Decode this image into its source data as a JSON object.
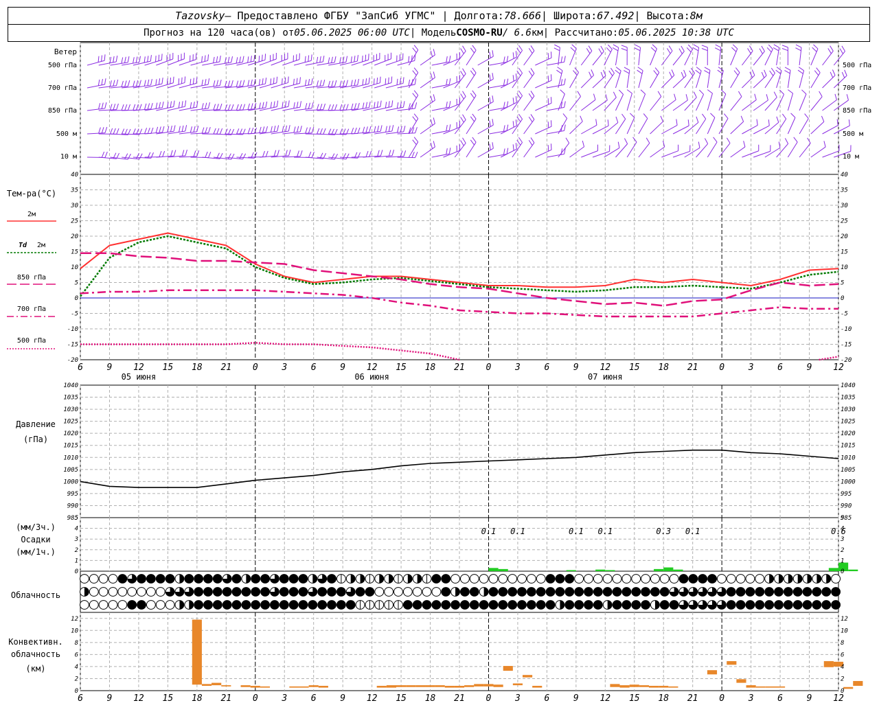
{
  "header": {
    "station": "Tazovsky",
    "provider": " – Предоставлено ФГБУ \"ЗапСиб УГМС\" | Долгота: ",
    "lon": "78.666",
    "lat_label": " | Широта: ",
    "lat": "67.492",
    "alt_label": " | Высота: ",
    "alt": "8м",
    "fc_prefix": "Прогноз на 120 часа(ов) от ",
    "fc_date": "05.06.2025 06:00 UTC",
    "model_label": "  | Модель ",
    "model": "COSMO-RU",
    "model_res": " / 6.6",
    "model_unit": "км",
    "calc_label": " | Рассчитано: ",
    "calc_date": "05.06.2025 10:38 UTC"
  },
  "colors": {
    "wind": "#8a2be2",
    "t2m": "#ff3030",
    "td2m": "#007a00",
    "t850": "#e0107a",
    "t700": "#e0107a",
    "t500": "#e0107a",
    "zero_line": "#1010c0",
    "pressure": "#000000",
    "precip": "#22cc22",
    "convective": "#e8872a"
  },
  "labels": {
    "wind_title": "Ветер",
    "wind_levels": [
      "500 гПа",
      "700 гПа",
      "850 гПа",
      "500 м",
      "10  м"
    ],
    "temp_title": "Тем-ра(°C)",
    "t2m": "2м",
    "td_a": "Td",
    "td_b": "2м",
    "t850": "850 гПа",
    "t700": "700 гПа",
    "t500": "500 гПа",
    "pressure_a": "Давление",
    "pressure_b": "(гПа)",
    "precip_a": "(мм/3ч.)",
    "precip_b": "Осадки",
    "precip_c": "(мм/1ч.)",
    "clouds": "Облачность",
    "conv_a": "Конвективн.",
    "conv_b": "облачность",
    "conv_c": "(км)"
  },
  "chart_data": [
    {
      "id": "wind",
      "type": "wind_barbs",
      "title": "Ветер",
      "levels": [
        "500 гПа",
        "700 гПа",
        "850 гПа",
        "500 м",
        "10  м"
      ]
    },
    {
      "id": "temperature",
      "type": "line",
      "ylabel": "Тем-ра(°C)",
      "ylim": [
        -20,
        40
      ],
      "yticks": [
        -20,
        -15,
        -10,
        -5,
        0,
        5,
        10,
        15,
        20,
        25,
        30,
        35,
        40
      ],
      "x_hours_from_start": [
        0,
        3,
        6,
        9,
        12,
        15,
        18,
        21,
        24,
        27,
        30,
        33,
        36,
        39,
        42,
        45,
        48,
        51,
        54,
        57,
        60,
        63,
        66,
        69,
        72,
        75,
        78
      ],
      "series": [
        {
          "name": "2м",
          "values": [
            9.5,
            17,
            19,
            21,
            19,
            17,
            11,
            7,
            5,
            6,
            7,
            7,
            6,
            5,
            4,
            4,
            3.5,
            3.5,
            4,
            6,
            5,
            6,
            5,
            4,
            6,
            9,
            9.5
          ]
        },
        {
          "name": "Td 2м",
          "values": [
            0.5,
            13,
            18,
            20,
            18,
            16,
            10,
            6.5,
            4.5,
            5,
            6,
            6.5,
            5.5,
            4.5,
            3.5,
            3,
            2.5,
            2,
            2.5,
            3.5,
            3.5,
            4,
            3.5,
            3,
            5,
            7.5,
            8.5
          ]
        },
        {
          "name": "850 гПа",
          "values": [
            14.5,
            14.5,
            13.5,
            13,
            12,
            12,
            11.5,
            11,
            9,
            8,
            7,
            6,
            4.5,
            3.5,
            3,
            1.5,
            0,
            -1,
            -2,
            -1.5,
            -2.5,
            -1,
            -0.5,
            2.5,
            5,
            4,
            4.5
          ]
        },
        {
          "name": "700 гПа",
          "values": [
            1.5,
            2,
            2,
            2.5,
            2.5,
            2.5,
            2.5,
            2,
            1.5,
            1,
            0,
            -1.5,
            -2.5,
            -4,
            -4.5,
            -5,
            -5,
            -5.5,
            -6,
            -6,
            -6,
            -6,
            -5,
            -4,
            -3,
            -3.5,
            -3.5
          ]
        },
        {
          "name": "500 гПа",
          "values": [
            -15,
            -15,
            -15,
            -15,
            -15,
            -15,
            -14.5,
            -15,
            -15,
            -15.5,
            -16,
            -17,
            -18,
            -20
          ]
        }
      ]
    },
    {
      "id": "pressure",
      "type": "line",
      "ylabel": "Давление (гПа)",
      "ylim": [
        985,
        1040
      ],
      "yticks": [
        985,
        990,
        995,
        1000,
        1005,
        1010,
        1015,
        1020,
        1025,
        1030,
        1035,
        1040
      ],
      "x_hours_from_start": [
        0,
        3,
        6,
        9,
        12,
        15,
        18,
        21,
        24,
        27,
        30,
        33,
        36,
        39,
        42,
        45,
        48,
        51,
        54,
        57,
        60,
        63,
        66,
        69,
        72,
        75,
        78
      ],
      "series": [
        {
          "name": "Давление",
          "values": [
            1000,
            998,
            997.5,
            997.5,
            997.5,
            999,
            1000.5,
            1001.5,
            1002.5,
            1004,
            1005,
            1006.5,
            1007.5,
            1008,
            1008.5,
            1009,
            1009.5,
            1010,
            1011,
            1012,
            1012.5,
            1013,
            1013,
            1012,
            1011.5,
            1010.5,
            1009.5
          ]
        }
      ]
    },
    {
      "id": "precipitation",
      "type": "bar",
      "ylabel": "Осадки (мм/3ч.) (мм/1ч.)",
      "ylim": [
        0,
        5
      ],
      "yticks": [
        0,
        1,
        2,
        3,
        4,
        5
      ],
      "annotations": [
        {
          "text": "0.1",
          "x_hours": 42
        },
        {
          "text": "0.1",
          "x_hours": 45
        },
        {
          "text": "0.1",
          "x_hours": 51
        },
        {
          "text": "0.1",
          "x_hours": 54
        },
        {
          "text": "0.3",
          "x_hours": 60
        },
        {
          "text": "0.1",
          "x_hours": 63
        },
        {
          "text": "0.6",
          "x_hours": 78
        }
      ],
      "bars": [
        {
          "x_hours": 42.5,
          "value": 0.3
        },
        {
          "x_hours": 43.5,
          "value": 0.2
        },
        {
          "x_hours": 50.5,
          "value": 0.1
        },
        {
          "x_hours": 53.5,
          "value": 0.15
        },
        {
          "x_hours": 54.5,
          "value": 0.1
        },
        {
          "x_hours": 59.5,
          "value": 0.2
        },
        {
          "x_hours": 60.5,
          "value": 0.35
        },
        {
          "x_hours": 61.5,
          "value": 0.15
        },
        {
          "x_hours": 77.5,
          "value": 0.3
        },
        {
          "x_hours": 78.5,
          "value": 0.8
        },
        {
          "x_hours": 79.5,
          "value": 0.15
        }
      ]
    },
    {
      "id": "cloudiness",
      "type": "symbols",
      "ylabel": "Облачность",
      "rows": 3
    },
    {
      "id": "convective",
      "type": "bar",
      "ylabel": "Конвективн. облачность (км)",
      "ylim": [
        0,
        13
      ],
      "yticks": [
        0,
        2,
        4,
        6,
        8,
        10,
        12
      ],
      "bars": [
        {
          "x_hours": 12,
          "bottom": 1,
          "top": 11.8
        },
        {
          "x_hours": 13,
          "bottom": 0.8,
          "top": 1.1
        },
        {
          "x_hours": 14,
          "bottom": 0.9,
          "top": 1.3
        },
        {
          "x_hours": 15,
          "bottom": 0.7,
          "top": 0.9
        },
        {
          "x_hours": 17,
          "bottom": 0.6,
          "top": 0.9
        },
        {
          "x_hours": 18,
          "bottom": 0.5,
          "top": 0.8
        },
        {
          "x_hours": 19,
          "bottom": 0.5,
          "top": 0.7
        },
        {
          "x_hours": 22,
          "bottom": 0.5,
          "top": 0.7
        },
        {
          "x_hours": 23,
          "bottom": 0.5,
          "top": 0.7
        },
        {
          "x_hours": 24,
          "bottom": 0.6,
          "top": 0.9
        },
        {
          "x_hours": 25,
          "bottom": 0.5,
          "top": 0.8
        },
        {
          "x_hours": 31,
          "bottom": 0.5,
          "top": 0.8
        },
        {
          "x_hours": 32,
          "bottom": 0.5,
          "top": 0.9
        },
        {
          "x_hours": 33,
          "bottom": 0.6,
          "top": 0.9
        },
        {
          "x_hours": 34,
          "bottom": 0.6,
          "top": 0.9
        },
        {
          "x_hours": 35,
          "bottom": 0.6,
          "top": 0.9
        },
        {
          "x_hours": 36,
          "bottom": 0.6,
          "top": 0.9
        },
        {
          "x_hours": 37,
          "bottom": 0.6,
          "top": 0.9
        },
        {
          "x_hours": 38,
          "bottom": 0.5,
          "top": 0.8
        },
        {
          "x_hours": 39,
          "bottom": 0.5,
          "top": 0.8
        },
        {
          "x_hours": 40,
          "bottom": 0.6,
          "top": 0.9
        },
        {
          "x_hours": 41,
          "bottom": 0.7,
          "top": 1.1
        },
        {
          "x_hours": 42,
          "bottom": 0.7,
          "top": 1.1
        },
        {
          "x_hours": 43,
          "bottom": 0.6,
          "top": 1.0
        },
        {
          "x_hours": 44,
          "bottom": 3.3,
          "top": 4.1
        },
        {
          "x_hours": 45,
          "bottom": 0.9,
          "top": 1.2
        },
        {
          "x_hours": 46,
          "bottom": 2.2,
          "top": 2.6
        },
        {
          "x_hours": 47,
          "bottom": 0.5,
          "top": 0.8
        },
        {
          "x_hours": 55,
          "bottom": 0.6,
          "top": 1.1
        },
        {
          "x_hours": 56,
          "bottom": 0.5,
          "top": 0.9
        },
        {
          "x_hours": 57,
          "bottom": 0.6,
          "top": 1.0
        },
        {
          "x_hours": 58,
          "bottom": 0.6,
          "top": 0.9
        },
        {
          "x_hours": 59,
          "bottom": 0.5,
          "top": 0.8
        },
        {
          "x_hours": 60,
          "bottom": 0.5,
          "top": 0.8
        },
        {
          "x_hours": 61,
          "bottom": 0.5,
          "top": 0.7
        },
        {
          "x_hours": 65,
          "bottom": 2.7,
          "top": 3.4
        },
        {
          "x_hours": 67,
          "bottom": 4.3,
          "top": 4.9
        },
        {
          "x_hours": 68,
          "bottom": 1.3,
          "top": 1.9
        },
        {
          "x_hours": 69,
          "bottom": 0.5,
          "top": 0.9
        },
        {
          "x_hours": 70,
          "bottom": 0.5,
          "top": 0.7
        },
        {
          "x_hours": 71,
          "bottom": 0.5,
          "top": 0.7
        },
        {
          "x_hours": 72,
          "bottom": 0.5,
          "top": 0.7
        },
        {
          "x_hours": 77,
          "bottom": 3.9,
          "top": 4.9
        },
        {
          "x_hours": 78,
          "bottom": 4.0,
          "top": 4.8
        },
        {
          "x_hours": 79,
          "bottom": 0.3,
          "top": 0.6
        },
        {
          "x_hours": 80,
          "bottom": 0.8,
          "top": 1.6
        }
      ]
    }
  ],
  "x_axis": {
    "tick_labels": [
      "6",
      "9",
      "12",
      "15",
      "18",
      "21",
      "0",
      "3",
      "6",
      "9",
      "12",
      "15",
      "18",
      "21",
      "0",
      "3",
      "6",
      "9",
      "12",
      "15",
      "18",
      "21",
      "0",
      "3",
      "6",
      "9",
      "12"
    ],
    "day_labels": [
      {
        "text": "05 июня",
        "tick_index": 2
      },
      {
        "text": "06 июня",
        "tick_index": 10
      },
      {
        "text": "07 июня",
        "tick_index": 18
      }
    ]
  }
}
